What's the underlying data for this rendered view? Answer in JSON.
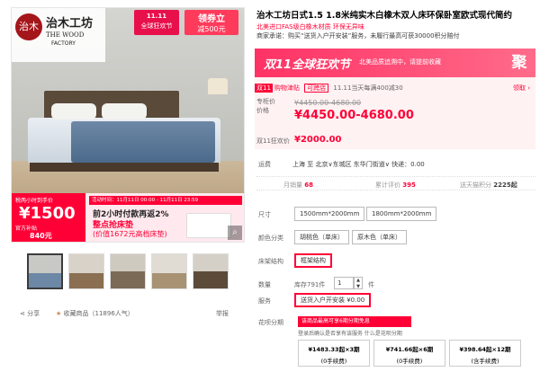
{
  "left": {
    "brand": {
      "logo": "治木",
      "name": "治木工坊",
      "sub1": "THE WOOD",
      "sub2": "FACTORY"
    },
    "badge_1111": {
      "line1": "11.11",
      "line2": "全球狂欢节"
    },
    "coupon": {
      "line1": "领券立",
      "line2": "减500元"
    },
    "promo": {
      "price_label": "税两小时到手价",
      "price": "¥1500",
      "subsidy_label": "官方补贴",
      "subsidy": "840元",
      "time": "活动时间：11月11日 00:00 - 11月11日 23:59",
      "line1": "前2小时付款再返2%",
      "line2": "整点抢床垫",
      "line3": "(价值1672元高档床垫)"
    },
    "zoom_icon": "⌕",
    "share_label": "分享",
    "fav_label": "收藏商品",
    "fav_count": "（11896人气）",
    "report_label": "举报"
  },
  "right": {
    "title": "治木工坊日式1.5 1.8米纯实木白橡木双人床环保卧室欧式现代简约",
    "subtitle": "北美进口FAS级白橡木材质 环保无异味",
    "notice": "商家承诺：购买“送货入户开安装”服务，未履行最高可获30000积分赔付",
    "banner": {
      "title": "双11全球狂欢节",
      "text": "北美品质追溯中，请提前收藏",
      "right": "聚"
    },
    "price": {
      "tag1": "双11",
      "tag2": "购物津贴",
      "tag3": "可跨店",
      "promo_text": "11.11当天每满400减30",
      "claim": "领取",
      "label_zhuangui": "专柜价",
      "label_jiage": "价格",
      "old_price": "¥4450.00-4680.00",
      "price": "¥4450.00-4680.00",
      "label_d11": "双11狂欢价",
      "d11_price": "¥2000.00"
    },
    "delivery": {
      "label": "运费",
      "text": "上海 至 北京∨东城区 东华门街道∨ 快递：0.00"
    },
    "stats": {
      "monthly_label": "月销量",
      "monthly": "68",
      "reviews_label": "累计评价",
      "reviews": "395",
      "points_label": "送天猫积分",
      "points": "2225起"
    },
    "size": {
      "label": "尺寸",
      "options": [
        "1500mm*2000mm",
        "1800mm*2000mm"
      ]
    },
    "color": {
      "label": "颜色分类",
      "options": [
        "胡桃色（单床）",
        "原木色（单床）"
      ]
    },
    "structure": {
      "label": "床架结构",
      "options": [
        "框架结构"
      ]
    },
    "qty": {
      "label": "数量",
      "stock": "库存791件",
      "value": "1",
      "unit": "件"
    },
    "service": {
      "label": "服务",
      "option": "送货入户开安装 ¥0.00"
    },
    "huabei": {
      "label": "花呗分期",
      "note": "该商品最高可享6期分期免息",
      "sub": "登录后确认是否享有该服务 什么是花呗分期",
      "plans": [
        {
          "amount": "¥1483.33起×3期",
          "fee": "(0手续费)"
        },
        {
          "amount": "¥741.66起×6期",
          "fee": "(0手续费)"
        },
        {
          "amount": "¥398.64起×12期",
          "fee": "(含手续费)"
        }
      ]
    }
  }
}
